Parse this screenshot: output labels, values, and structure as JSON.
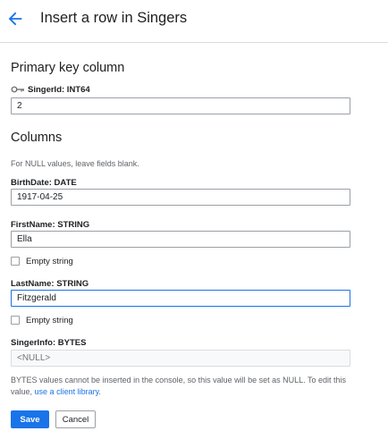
{
  "header": {
    "back_icon": "arrow-back-icon",
    "title": "Insert a row in Singers"
  },
  "primary_key": {
    "section_title": "Primary key column",
    "key_icon": "key-icon",
    "label": "SingerId: INT64",
    "value": "2"
  },
  "columns": {
    "section_title": "Columns",
    "hint": "For NULL values, leave fields blank.",
    "birthdate": {
      "label": "BirthDate: DATE",
      "value": "1917-04-25"
    },
    "firstname": {
      "label": "FirstName: STRING",
      "value": "Ella",
      "empty_string_label": "Empty string",
      "empty_string_checked": false
    },
    "lastname": {
      "label": "LastName: STRING",
      "value": "Fitzgerald",
      "empty_string_label": "Empty string",
      "empty_string_checked": false
    },
    "singerinfo": {
      "label": "SingerInfo: BYTES",
      "placeholder": "<NULL>",
      "note": "BYTES values cannot be inserted in the console, so this value will be set as NULL. To edit this value,",
      "note_link": "use a client library",
      "note_end": "."
    }
  },
  "actions": {
    "save_label": "Save",
    "cancel_label": "Cancel"
  },
  "colors": {
    "accent": "#1a73e8",
    "text": "#202124",
    "muted": "#5f6368",
    "border": "#9aa0a6"
  }
}
